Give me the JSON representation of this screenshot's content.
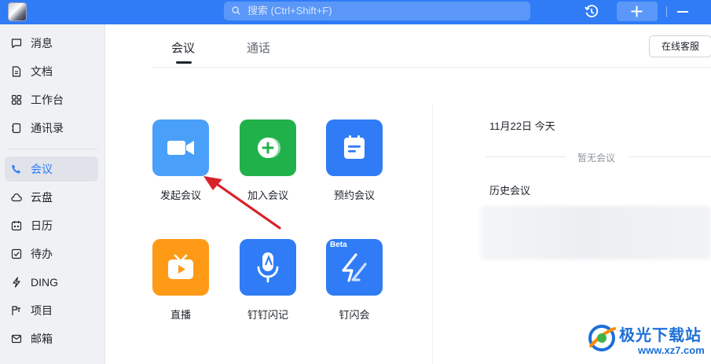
{
  "colors": {
    "accent": "#2f7cf6",
    "green": "#21b14a",
    "orange": "#ff9a17",
    "arrow": "#d9212a"
  },
  "topbar": {
    "search_placeholder": "搜索 (Ctrl+Shift+F)"
  },
  "sidebar": {
    "items": [
      {
        "label": "消息",
        "icon": "chat-icon"
      },
      {
        "label": "文档",
        "icon": "document-icon"
      },
      {
        "label": "工作台",
        "icon": "grid-icon"
      },
      {
        "label": "通讯录",
        "icon": "contacts-icon"
      },
      {
        "label": "会议",
        "icon": "phone-icon",
        "active": true
      },
      {
        "label": "云盘",
        "icon": "cloud-icon"
      },
      {
        "label": "日历",
        "icon": "calendar-icon"
      },
      {
        "label": "待办",
        "icon": "checkbox-icon"
      },
      {
        "label": "DING",
        "icon": "lightning-icon"
      },
      {
        "label": "项目",
        "icon": "project-icon"
      },
      {
        "label": "邮箱",
        "icon": "mail-icon"
      }
    ]
  },
  "tabs": {
    "meeting": "会议",
    "call": "通话"
  },
  "service_button": "在线客服",
  "apps": [
    {
      "label": "发起会议",
      "icon": "video-camera-icon"
    },
    {
      "label": "加入会议",
      "icon": "join-plus-icon"
    },
    {
      "label": "预约会议",
      "icon": "calendar-schedule-icon"
    },
    {
      "label": "直播",
      "icon": "tv-play-icon"
    },
    {
      "label": "钉钉闪记",
      "icon": "microphone-icon"
    },
    {
      "label": "钉闪会",
      "icon": "flash-icon",
      "badge": "Beta"
    }
  ],
  "schedule": {
    "date": "11月22日 今天",
    "empty": "暂无会议",
    "history_title": "历史会议"
  },
  "watermark": {
    "title": "极光下载站",
    "url": "www.xz7.com"
  }
}
